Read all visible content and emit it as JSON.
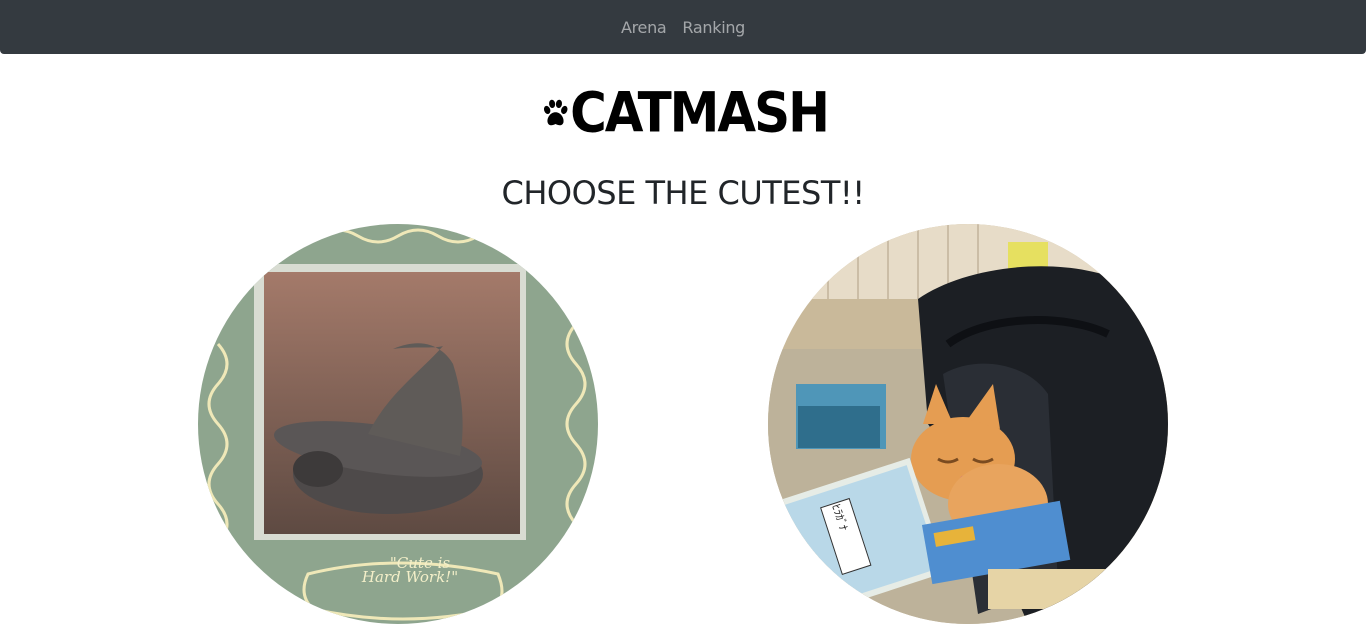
{
  "nav": {
    "links": [
      {
        "label": "Arena"
      },
      {
        "label": "Ranking"
      }
    ]
  },
  "logo": {
    "text": "CATMASH"
  },
  "page": {
    "title": "CHOOSE THE CUTEST!!"
  },
  "cats": [
    {
      "poster_caption_line1": "\"Cute is",
      "poster_caption_line2": "Hard Work!\""
    },
    {
      "book_label": "ﾋﾗｶﾞﾅ"
    }
  ]
}
